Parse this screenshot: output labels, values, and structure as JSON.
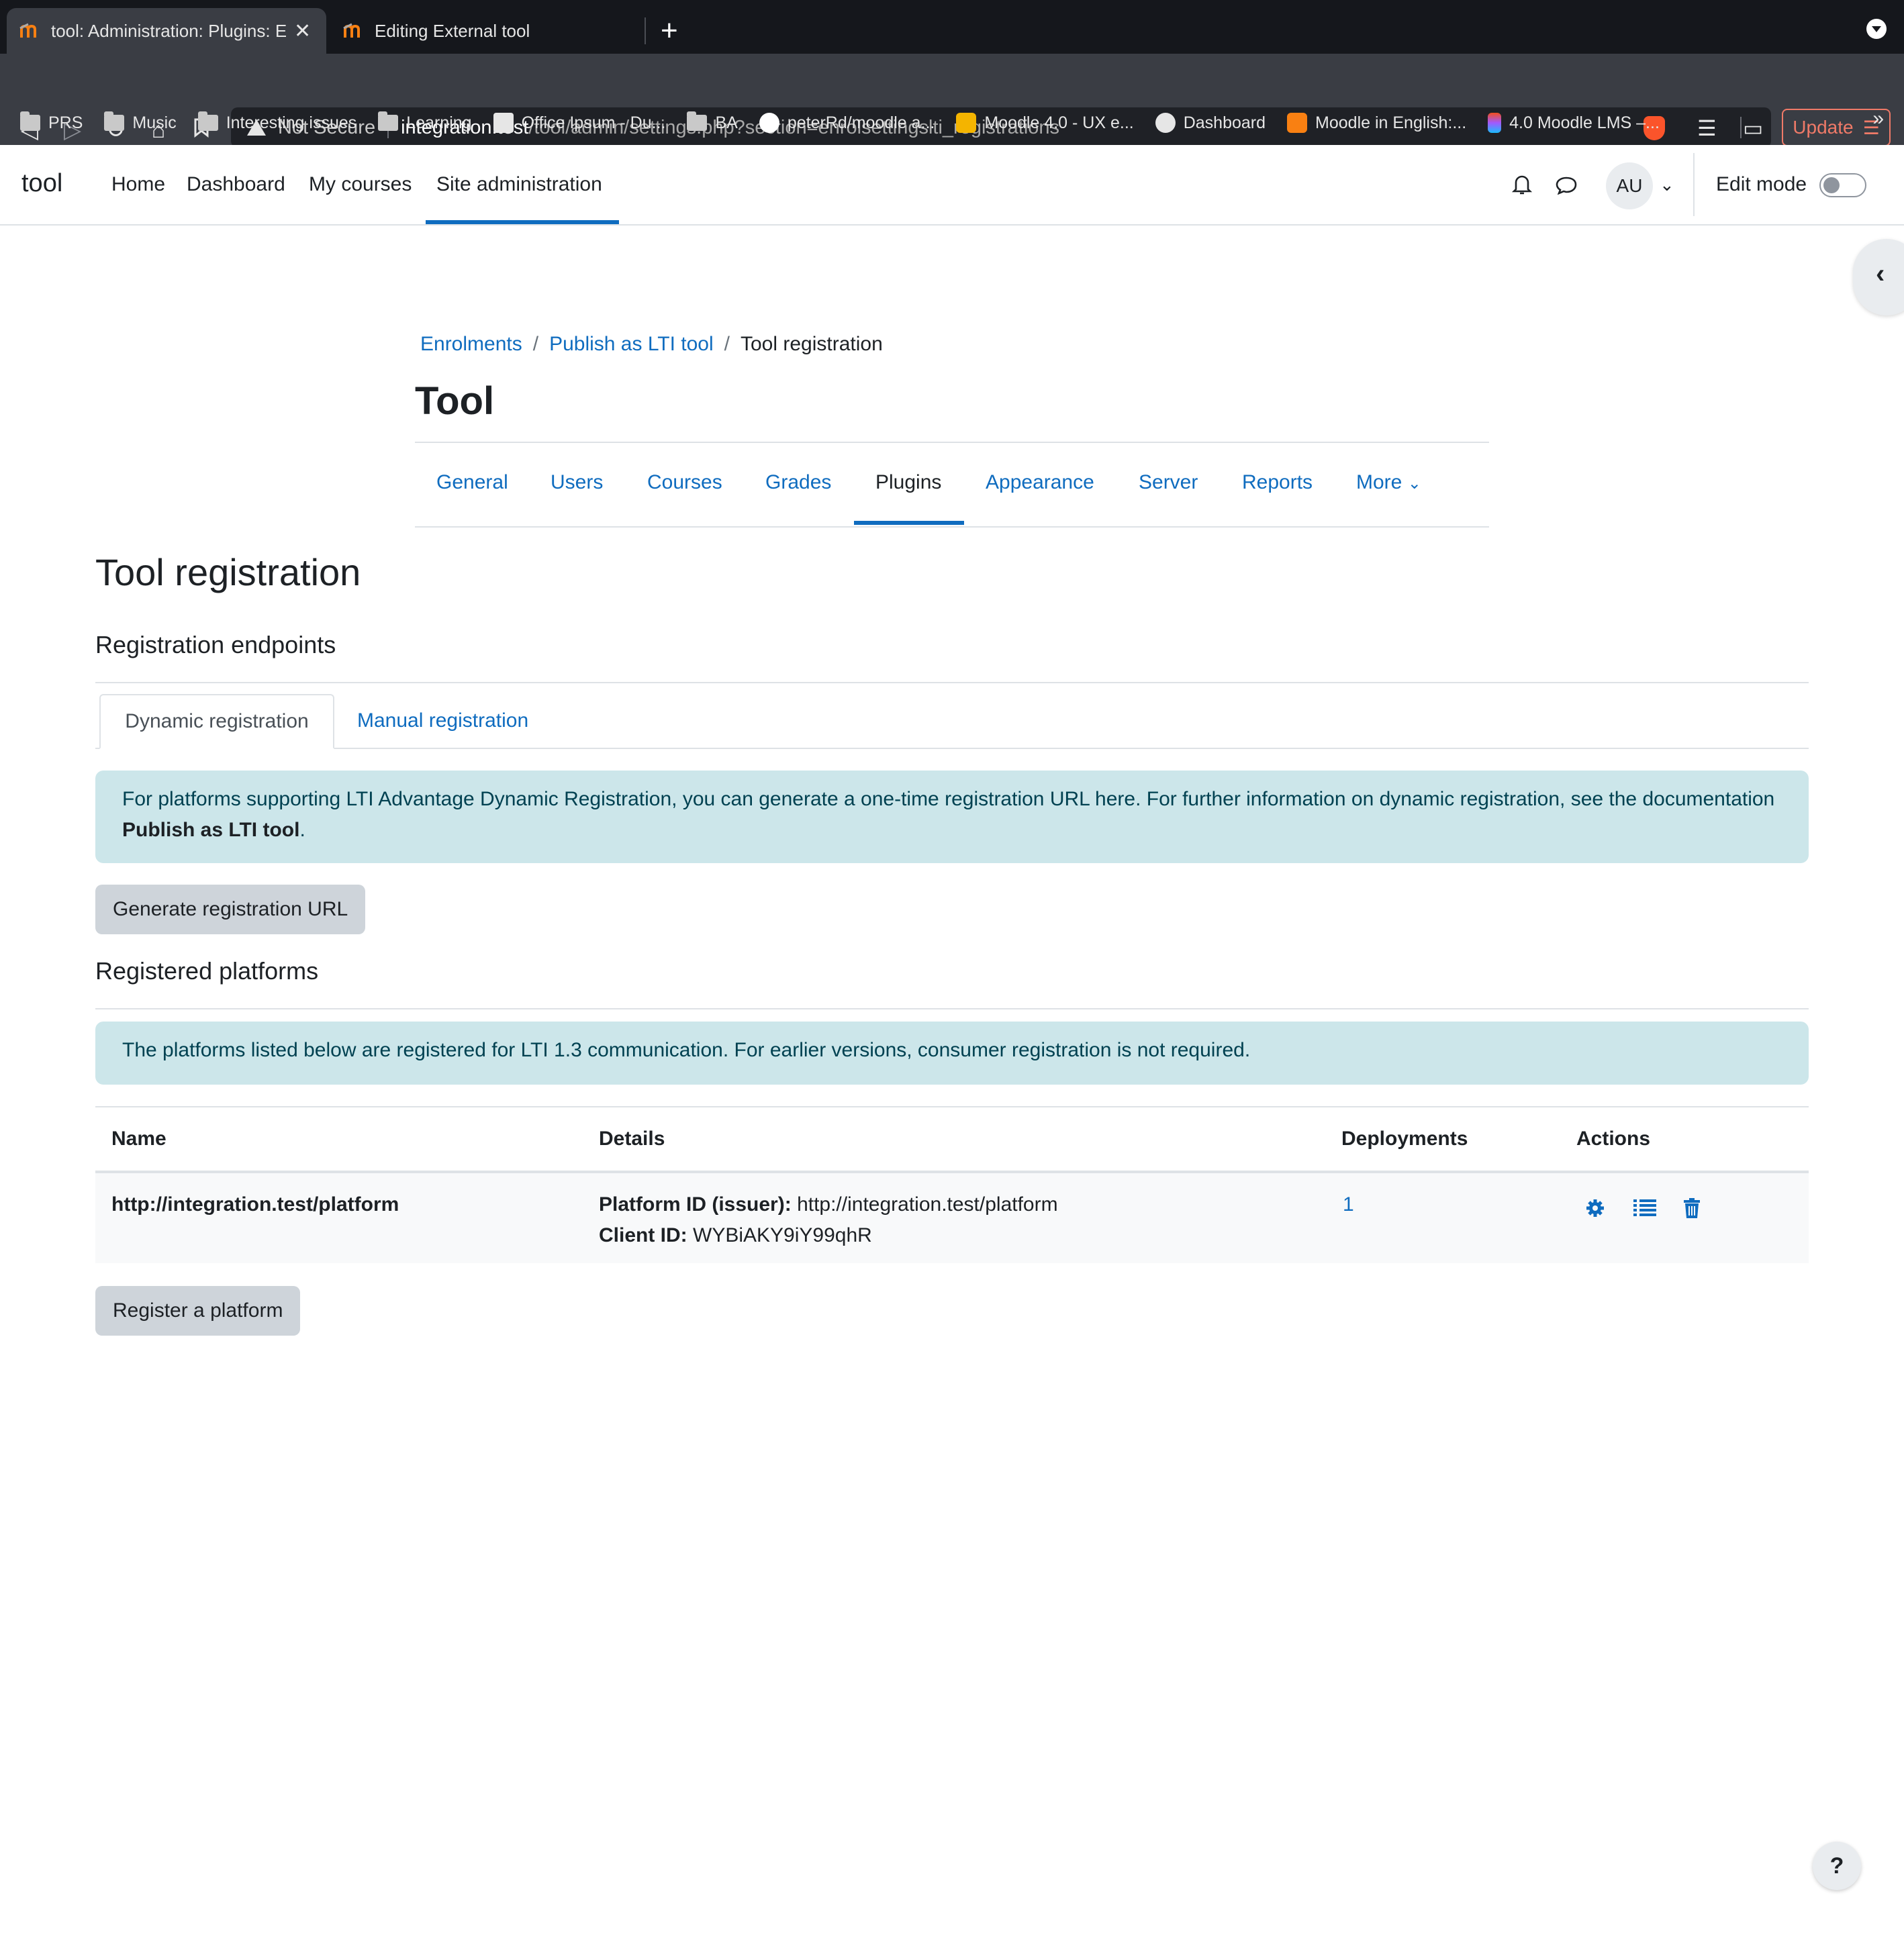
{
  "browser": {
    "tabs": [
      {
        "title": "tool: Administration: Plugins: Enrolments: Publish as LTI tool: Tool registration",
        "active": true
      },
      {
        "title": "Editing External tool",
        "active": false
      }
    ],
    "url": {
      "security": "Not Secure",
      "host": "integration.test",
      "path": "/tool/admin/settings.php?section=enrolsettingslti_registrations"
    },
    "update_label": "Update",
    "bookmarks": [
      "PRS",
      "Music",
      "Interesting issues",
      "Learning",
      "Office Ipsum - Du...",
      "BA",
      "peterRd/moodle a...",
      "Moodle 4.0 - UX e...",
      "Dashboard",
      "Moodle in English:...",
      "4.0 Moodle LMS –..."
    ],
    "bookmarks_more": "»"
  },
  "moodle_nav": {
    "brand": "tool",
    "links": [
      "Home",
      "Dashboard",
      "My courses",
      "Site administration"
    ],
    "active_link": "Site administration",
    "avatar_initials": "AU",
    "edit_mode_label": "Edit mode",
    "edit_mode_on": false
  },
  "breadcrumb": {
    "items": [
      "Enrolments",
      "Publish as LTI tool",
      "Tool registration"
    ],
    "separator": "/"
  },
  "page_title": "Tool",
  "secondary_nav": {
    "items": [
      "General",
      "Users",
      "Courses",
      "Grades",
      "Plugins",
      "Appearance",
      "Server",
      "Reports",
      "More"
    ],
    "active": "Plugins"
  },
  "content": {
    "heading": "Tool registration",
    "endpoints_heading": "Registration endpoints",
    "reg_tabs": [
      "Dynamic registration",
      "Manual registration"
    ],
    "dynamic_info_text": "For platforms supporting LTI Advantage Dynamic Registration, you can generate a one-time registration URL here. For further information on dynamic registration, see the documentation ",
    "dynamic_info_link": "Publish as LTI tool",
    "dynamic_info_end": ".",
    "generate_button": "Generate registration URL",
    "platforms_heading": "Registered platforms",
    "platforms_info": "The platforms listed below are registered for LTI 1.3 communication. For earlier versions, consumer registration is not required.",
    "table": {
      "headers": [
        "Name",
        "Details",
        "Deployments",
        "Actions"
      ],
      "rows": [
        {
          "name": "http://integration.test/platform",
          "platform_id_label": "Platform ID (issuer):",
          "platform_id": "http://integration.test/platform",
          "client_id_label": "Client ID:",
          "client_id": "WYBiAKY9iY99qhR",
          "deployments": "1",
          "actions": [
            "gear-icon",
            "list-icon",
            "trash-icon"
          ]
        }
      ]
    },
    "register_button": "Register a platform"
  },
  "help_label": "?",
  "colors": {
    "link": "#0f6cbf",
    "alert_bg": "#cce6ea",
    "alert_text": "#004151",
    "button_bg": "#ced4da"
  }
}
